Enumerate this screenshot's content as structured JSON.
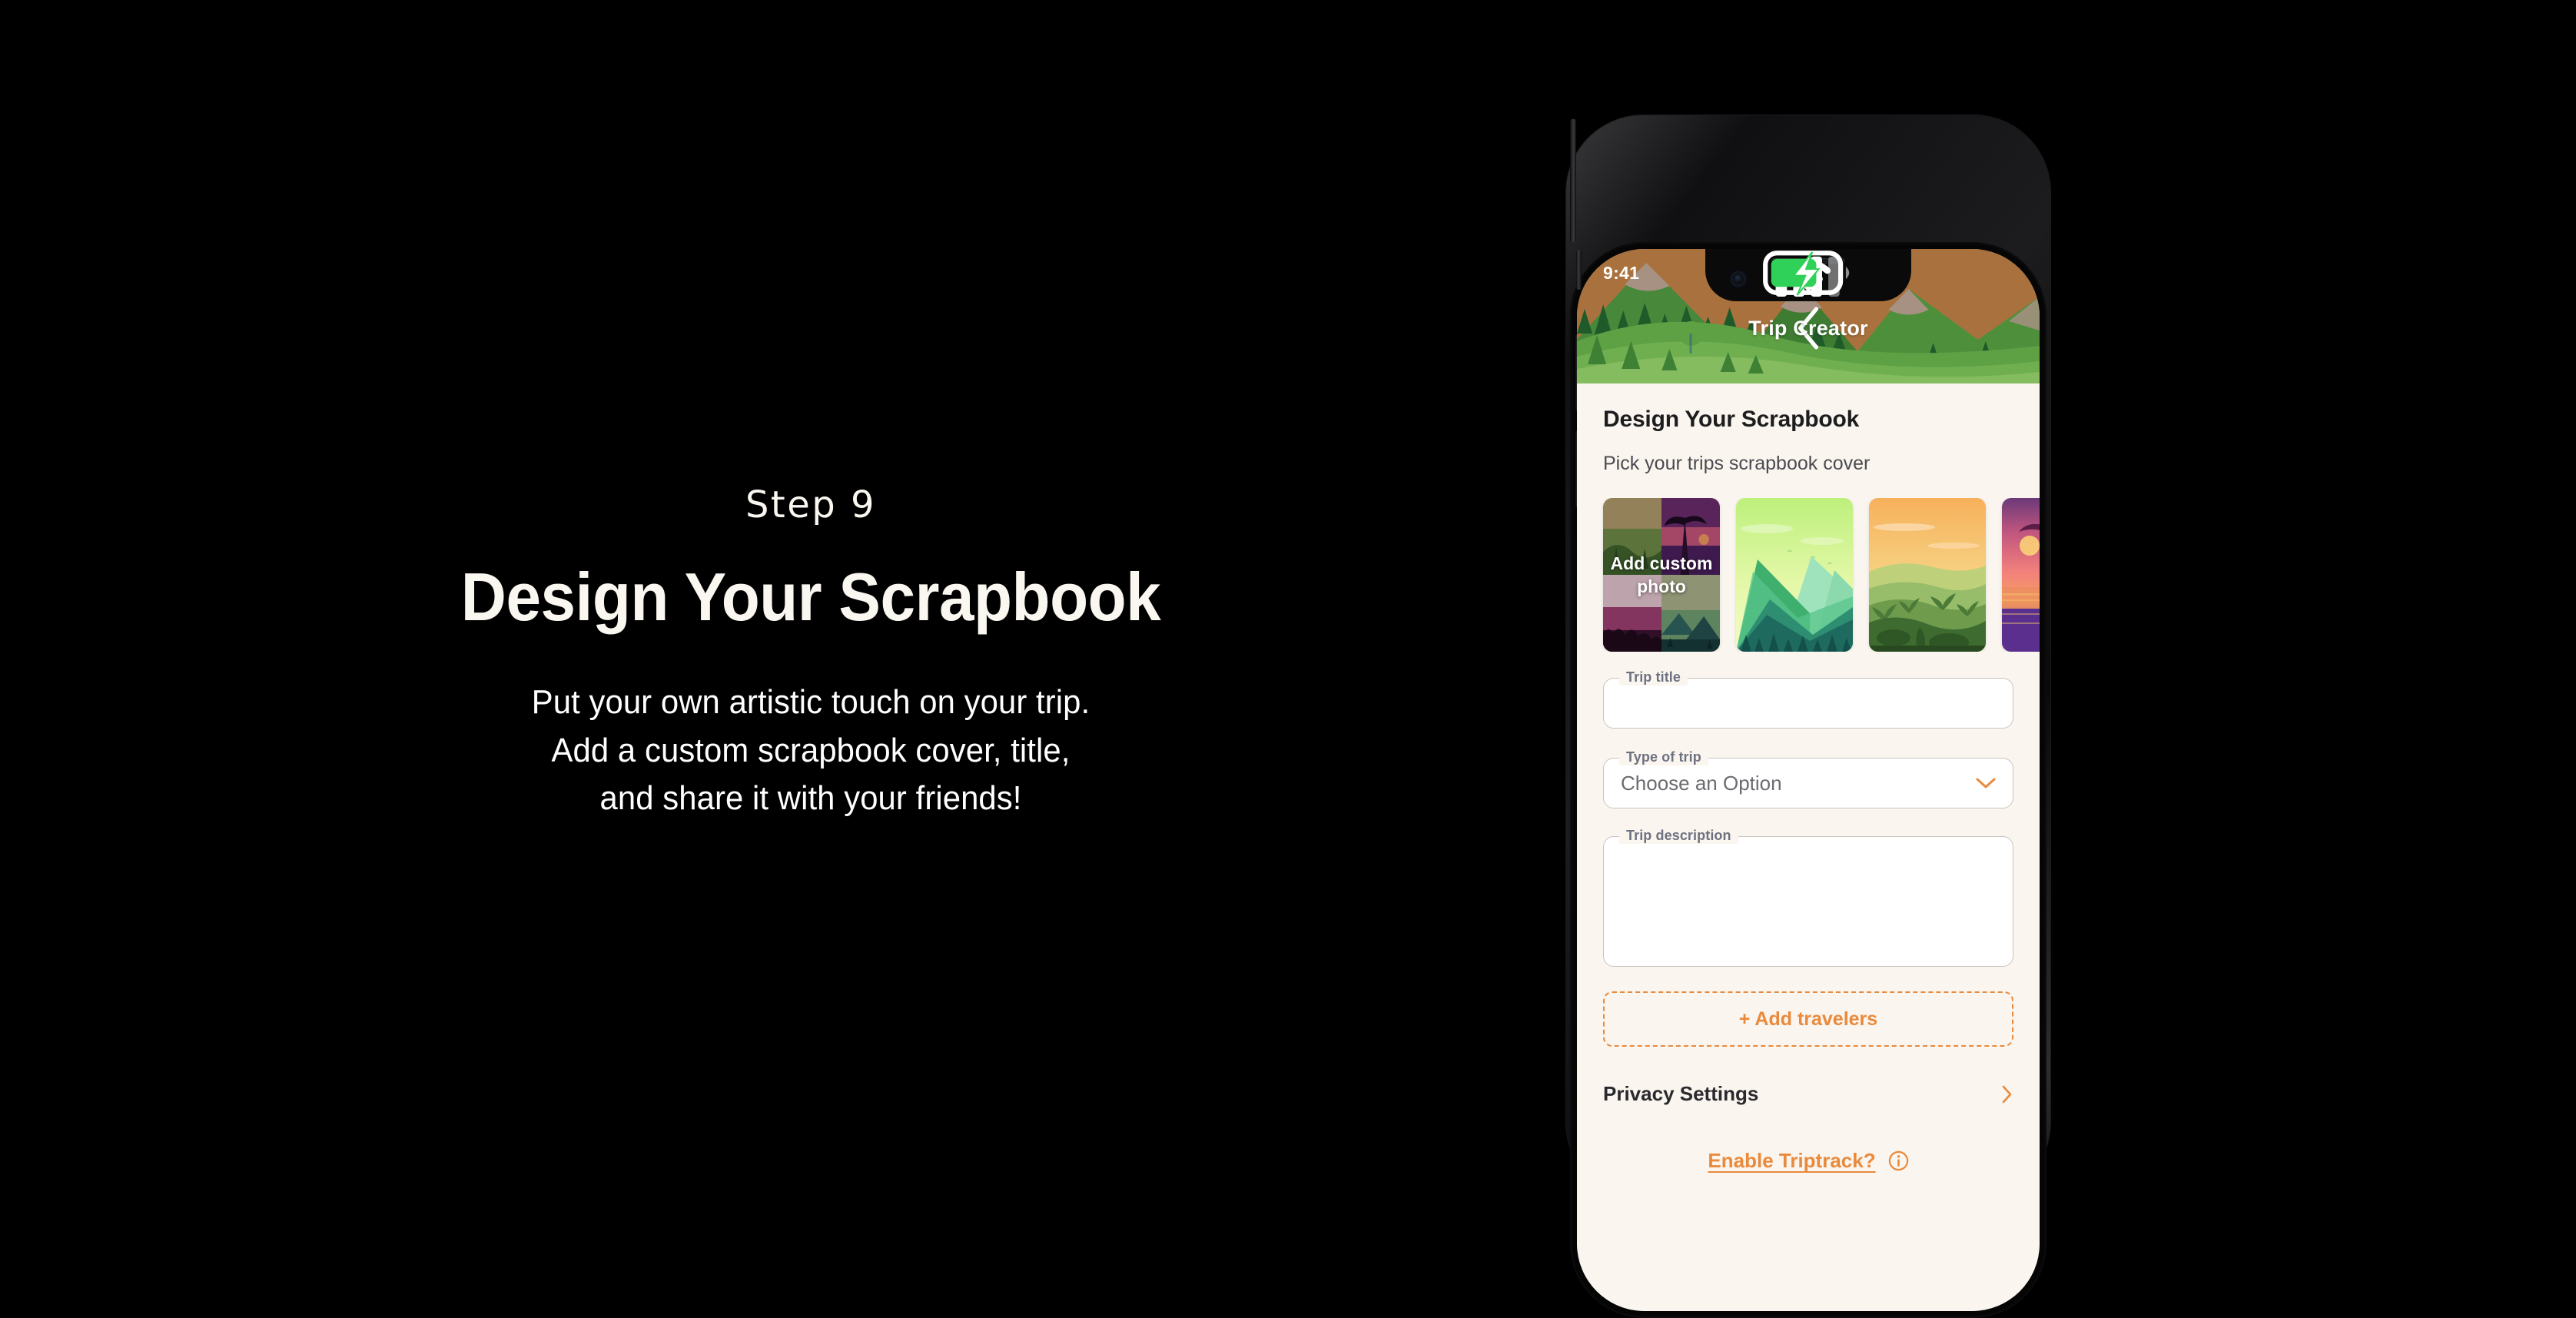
{
  "promo": {
    "step_label": "Step 9",
    "title": "Design Your Scrapbook",
    "subtitle_lines": [
      "Put your own artistic touch on your trip.",
      "Add a custom scrapbook cover, title,",
      "and share it with your friends!"
    ],
    "background_color": "#000000",
    "text_color": "#FAF6F0"
  },
  "phone": {
    "status_bar": {
      "time": "9:41",
      "icons": [
        "cellular-signal-icon",
        "wifi-icon",
        "battery-charging-icon"
      ],
      "battery_charging": true
    },
    "nav": {
      "back_icon": "chevron-left-icon",
      "title": "Trip Creator"
    },
    "screen": {
      "heading": "Design Your Scrapbook",
      "subheading": "Pick your trips scrapbook cover",
      "covers": [
        {
          "id": "add-custom-photo",
          "label": "Add custom photo",
          "type": "collage",
          "selected": false
        },
        {
          "id": "green-mountains",
          "label": "",
          "type": "photo",
          "selected": false
        },
        {
          "id": "orange-jungle",
          "label": "",
          "type": "photo",
          "selected": false
        },
        {
          "id": "sunset-beach",
          "label": "",
          "type": "photo",
          "selected": false
        }
      ],
      "fields": {
        "trip_title": {
          "legend": "Trip title",
          "value": "",
          "placeholder": ""
        },
        "type_of_trip": {
          "legend": "Type of trip",
          "value": "Choose an Option",
          "chevron": "chevron-down-icon"
        },
        "trip_description": {
          "legend": "Trip description",
          "value": "",
          "placeholder": ""
        }
      },
      "add_travelers_label": "+ Add travelers",
      "privacy_settings_label": "Privacy Settings",
      "privacy_settings_chevron": "chevron-right-icon",
      "triptrack_label": "Enable Triptrack?",
      "triptrack_info_icon": "info-circle-icon"
    },
    "colors": {
      "accent": "#E98A3C",
      "screen_background": "#FAF5EF",
      "hero_sky": "#A9713D",
      "hero_mountain": "#4C8A3A",
      "heading_text": "#1d1d1f",
      "field_border": "#C9C4BD",
      "legend_text": "#6E7180"
    }
  }
}
